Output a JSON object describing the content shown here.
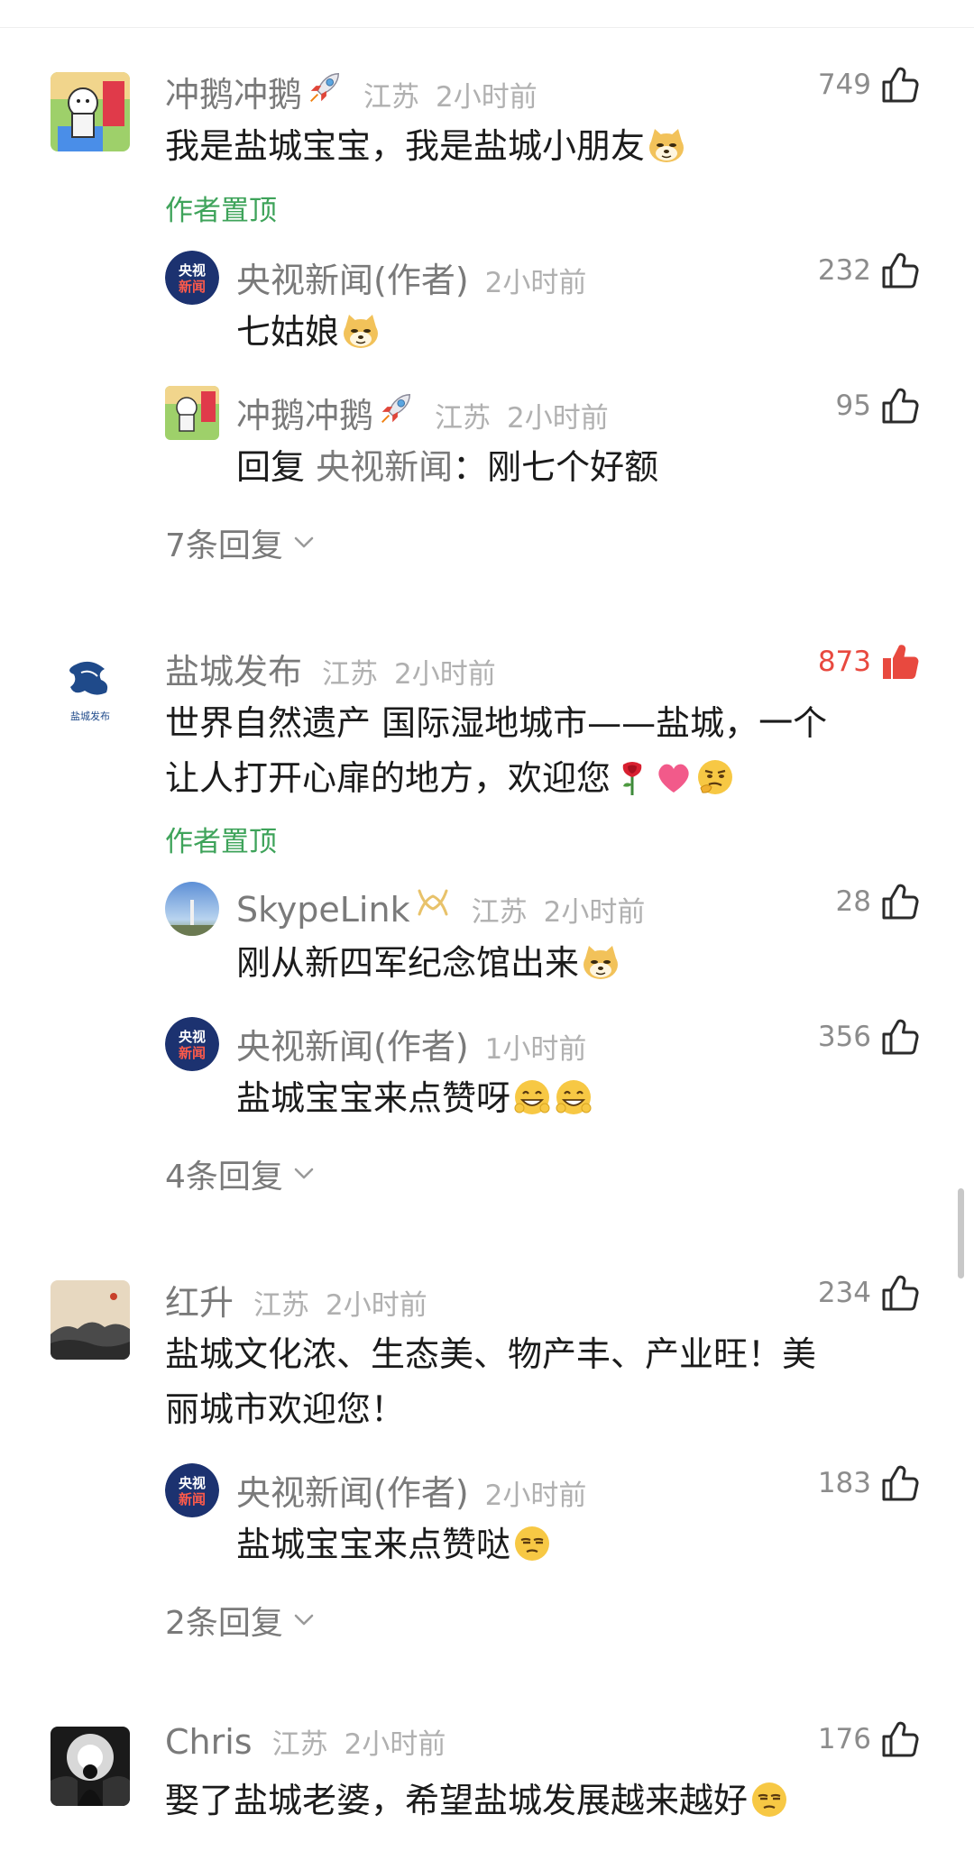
{
  "comments": [
    {
      "author": "冲鹅冲鹅",
      "location": "江苏",
      "time": "2小时前",
      "likes": "749",
      "text": "我是盐城宝宝，我是盐城小朋友",
      "pinned": "作者置顶",
      "replies": [
        {
          "author": "央视新闻(作者)",
          "time": "2小时前",
          "likes": "232",
          "text": "七姑娘"
        },
        {
          "author": "冲鹅冲鹅",
          "location": "江苏",
          "time": "2小时前",
          "likes": "95",
          "prefix": "回复",
          "target": "央视新闻",
          "text": "：刚七个好额"
        }
      ],
      "more_replies": "7条回复"
    },
    {
      "author": "盐城发布",
      "location": "江苏",
      "time": "2小时前",
      "likes": "873",
      "liked": true,
      "text_line1": "世界自然遗产 国际湿地城市——盐城，一个",
      "text_line2": "让人打开心扉的地方，欢迎您",
      "pinned": "作者置顶",
      "avatar_caption": "盐城发布",
      "replies": [
        {
          "author": "SkypeLink",
          "location": "江苏",
          "time": "2小时前",
          "likes": "28",
          "text": "刚从新四军纪念馆出来"
        },
        {
          "author": "央视新闻(作者)",
          "time": "1小时前",
          "likes": "356",
          "text": "盐城宝宝来点赞呀"
        }
      ],
      "more_replies": "4条回复"
    },
    {
      "author": "红升",
      "location": "江苏",
      "time": "2小时前",
      "likes": "234",
      "text_line1": "盐城文化浓、生态美、物产丰、产业旺！美",
      "text_line2": "丽城市欢迎您！",
      "replies": [
        {
          "author": "央视新闻(作者)",
          "time": "2小时前",
          "likes": "183",
          "text": "盐城宝宝来点赞哒"
        }
      ],
      "more_replies": "2条回复"
    },
    {
      "author": "Chris",
      "location": "江苏",
      "time": "2小时前",
      "likes": "176",
      "text": "娶了盐城老婆，希望盐城发展越来越好"
    }
  ],
  "cctv_logo": {
    "line1": "央视",
    "line2": "新闻"
  },
  "colors": {
    "accent_green": "#3ea35a",
    "like_red": "#e8493f",
    "muted": "#7a7a7a"
  }
}
